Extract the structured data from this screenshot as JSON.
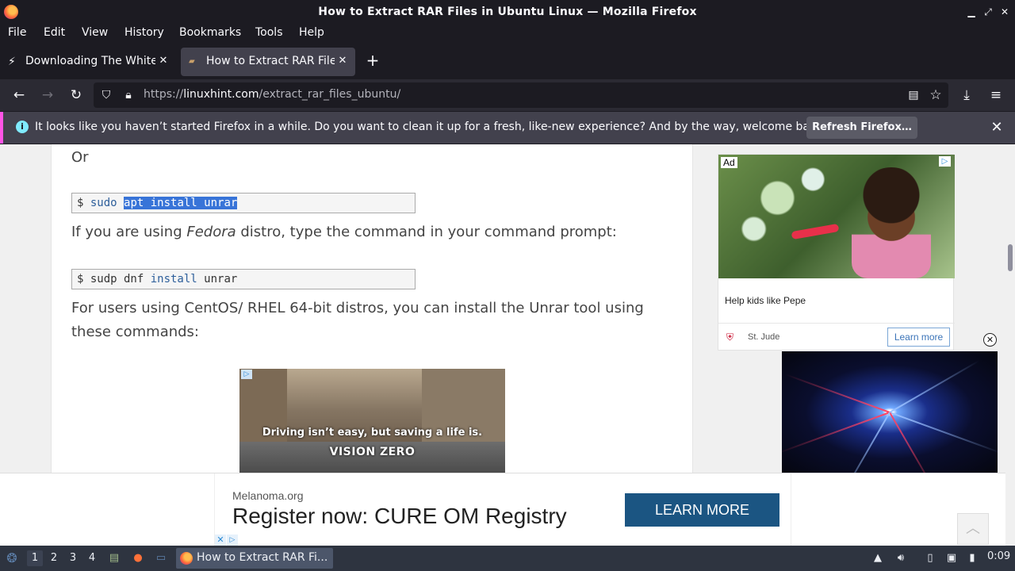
{
  "window": {
    "title": "How to Extract RAR Files in Ubuntu Linux — Mozilla Firefox",
    "minimize": "▁",
    "maximize": "⤢",
    "close": "✕"
  },
  "menu": [
    "File",
    "Edit",
    "View",
    "History",
    "Bookmarks",
    "Tools",
    "Help"
  ],
  "tabs": [
    {
      "label": "Downloading The White House",
      "icon": "lightning-icon",
      "active": false
    },
    {
      "label": "How to Extract RAR Files in Ubuntu",
      "icon": "linuxhint-icon",
      "active": true
    }
  ],
  "nav": {
    "url_prefix": "https://",
    "url_host": "linuxhint.com",
    "url_path": "/extract_rar_files_ubuntu/"
  },
  "notification": {
    "message": "It looks like you haven’t started Firefox in a while. Do you want to clean it up for a fresh, like-new experience? And by the way, welcome back!",
    "button": "Refresh Firefox…"
  },
  "article": {
    "or": "Or",
    "cmd1_prompt": "$ ",
    "cmd1_sudo": "sudo",
    "cmd1_selected": "apt install unrar",
    "fedora_pre": "If you are using ",
    "fedora_em": "Fedora",
    "fedora_post": " distro, type the command in your command prompt:",
    "cmd2_prompt": "$ ",
    "cmd2_a": "sudp dnf ",
    "cmd2_kw": "install",
    "cmd2_b": " unrar",
    "centos_line1": "For users using CentOS/ RHEL 64-bit distros, you can install the Unrar tool using",
    "centos_line2": "these commands:"
  },
  "video_ad": {
    "line1": "Driving isn’t easy, but saving a life is.",
    "line2": "VISION ZERO"
  },
  "side_ad": {
    "ad_label": "Ad",
    "headline": "Help kids like Pepe",
    "sponsor": "St. Jude",
    "button": "Learn more"
  },
  "bottom_ad": {
    "site": "Melanoma.org",
    "headline": "Register now: CURE OM Registry",
    "cta": "LEARN MORE"
  },
  "taskbar": {
    "workspaces": [
      "1",
      "2",
      "3",
      "4"
    ],
    "current_workspace": "1",
    "window_label": "How to Extract RAR Fi...",
    "clock": "0:09"
  },
  "colors": {
    "accent_selection": "#3874d8",
    "notification_stripe": "#ff54e6",
    "cta_blue": "#1b5582"
  }
}
